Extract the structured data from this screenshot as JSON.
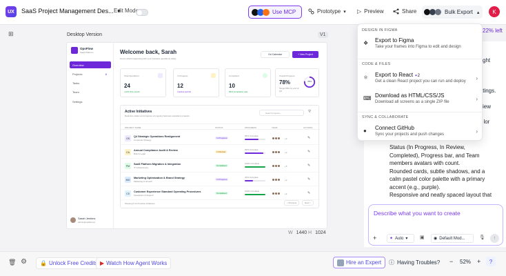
{
  "topbar": {
    "logo_text": "UX",
    "project_title": "SaaS Project Management Des...",
    "edit_mode": "Edit Mode",
    "use_mcp": "Use MCP",
    "prototype": "Prototype",
    "preview": "Preview",
    "share": "Share",
    "bulk_export": "Bulk Export",
    "user_initial": "K"
  },
  "canvas": {
    "desktop_label": "Desktop Version",
    "version": "V1",
    "w_label": "W",
    "w_value": "1440",
    "h_label": "H",
    "h_value": "1024"
  },
  "mini": {
    "brand": "OpsFlow",
    "brand_sub": "SaaS Platform",
    "nav": [
      "Overview",
      "Projects",
      "Tasks",
      "Team",
      "Settings"
    ],
    "projects_count": "6",
    "welcome": "Welcome back, Sarah",
    "welcome_sub": "Here's what's happening with your business operations today.",
    "gcal": "Gd Calendar",
    "new_project": "+ New Project",
    "stats": [
      {
        "label": "Total Operations",
        "value": "24",
        "note": "+12% this month"
      },
      {
        "label": "In Progress",
        "value": "12",
        "note": "4 active sprints"
      },
      {
        "label": "Completed",
        "value": "10",
        "note": "83% completion rate"
      },
      {
        "label": "Overall Progress",
        "value": "78%",
        "note": "Target 80% by end of Q4",
        "ring": "78%"
      }
    ],
    "initiatives_title": "Active Initiatives",
    "initiatives_sub": "Real-time status and progress of ongoing business operations projects.",
    "search_placeholder": "Search projects...",
    "columns": [
      "PROJECT NAME",
      "STATUS",
      "PROGRESS",
      "TEAM",
      "ACTIONS"
    ],
    "rows": [
      {
        "abbr": "OS",
        "name": "Q4 Strategic Operations Realignment",
        "sub": "Corporate Strategy",
        "status": "In Progress",
        "progress": "65% Complete",
        "pct": 65,
        "more": "+3"
      },
      {
        "abbr": "CA",
        "name": "Annual Compliance Audit & Review",
        "sub": "Risk & Legal",
        "status": "In Review",
        "progress": "90% Complete",
        "pct": 90,
        "more": "+2"
      },
      {
        "abbr": "PM",
        "name": "SaaS Platform Migration & Integration",
        "sub": "IT Infrastructure",
        "status": "Completed",
        "progress": "100% Complete",
        "pct": 100,
        "more": "+5"
      },
      {
        "abbr": "MO",
        "name": "Marketing Optimization & Brand Strategy",
        "sub": "Marketing & Growth",
        "status": "In Progress",
        "progress": "40% Complete",
        "pct": 40,
        "more": "+2"
      },
      {
        "abbr": "CS",
        "name": "Customer Experience Standard Operating Procedures",
        "sub": "Operations & Support",
        "status": "Completed",
        "progress": "100% Complete",
        "pct": 100,
        "more": "+4"
      }
    ],
    "footer_text": "Showing 5 of 24 active initiatives",
    "prev": "< Previous",
    "next": "Next >",
    "user_name": "Sarah Jenkins",
    "user_email": "admin@opsflow.co"
  },
  "panel": {
    "credits_left": "22% left",
    "text_lines": [
      "ght",
      "ttings.",
      "iew",
      "s, lor",
      "Status (In Progress, In Review,",
      "Completed), Progress bar, and Team",
      "members avatars with count.",
      "Rounded cards, subtle shadows, and a",
      "calm pastel color palette with a primary",
      "accent (e.g., purple).",
      "Responsive and neatly spaced layout that"
    ],
    "chat_placeholder": "Describe what you want to create",
    "auto": "Auto",
    "model": "Default Mod..."
  },
  "dropdown": {
    "sec_design": "DESIGN IN FIGMA",
    "figma_title": "Export to Figma",
    "figma_sub": "Take your frames into Figma to edit and design",
    "sec_code": "CODE & FILES",
    "react_title": "Export to React",
    "react_badge": "2",
    "react_sub": "Get a clean React project you can run and deploy",
    "html_title": "Download as HTML/CSS/JS",
    "html_sub": "Download all screens as a single ZIP file",
    "sec_sync": "SYNC & COLLABORATE",
    "github_title": "Connect GitHub",
    "github_sub": "Sync your projects and push changes"
  },
  "bottom": {
    "unlock": "Unlock Free Credits",
    "watch": "Watch How Agent Works",
    "hire": "Hire an Expert",
    "trouble": "Having Troubles?",
    "zoom": "52%",
    "help": "?"
  },
  "colors": {
    "accent": "#6d28d9",
    "brand_red": "#e11d48"
  }
}
